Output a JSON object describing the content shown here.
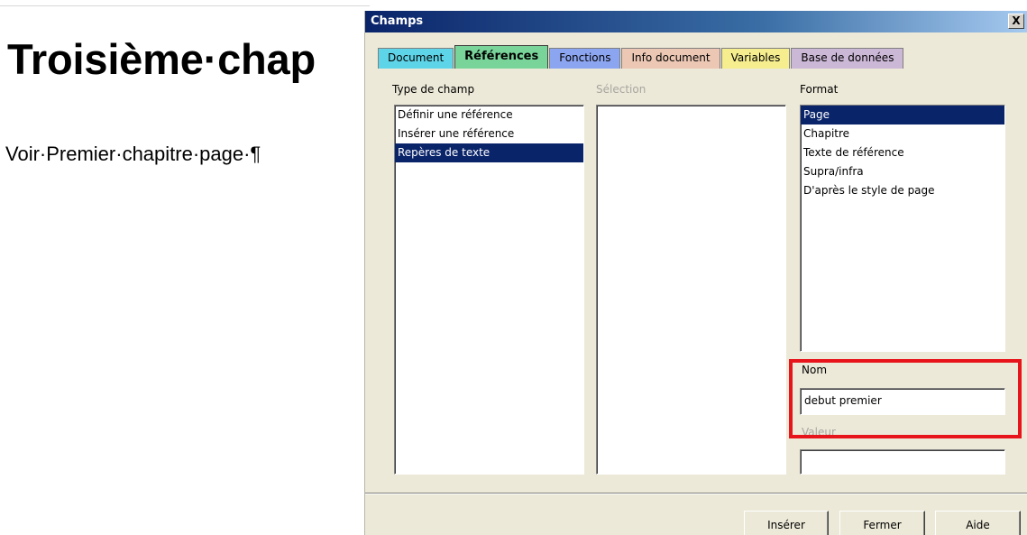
{
  "document": {
    "heading": "Troisième·chap",
    "paragraph": "Voir·Premier·chapitre·page·¶"
  },
  "dialog": {
    "title": "Champs",
    "close_glyph": "X",
    "tabs": [
      {
        "label": "Document",
        "color": "#5ed4e8"
      },
      {
        "label": "Références",
        "color": "#79d49a",
        "active": true
      },
      {
        "label": "Fonctions",
        "color": "#8ca5f0"
      },
      {
        "label": "Info document",
        "color": "#ecc7b4"
      },
      {
        "label": "Variables",
        "color": "#f5ed8e"
      },
      {
        "label": "Base de données",
        "color": "#cbb7d6"
      }
    ],
    "type_de_champ": {
      "label": "Type de champ",
      "items": [
        "Définir une référence",
        "Insérer une référence",
        "Repères de texte"
      ],
      "selected_index": 2
    },
    "selection": {
      "label": "Sélection",
      "items": []
    },
    "format": {
      "label": "Format",
      "items": [
        "Page",
        "Chapitre",
        "Texte de référence",
        "Supra/infra",
        "D'après le style de page"
      ],
      "selected_index": 0
    },
    "nom": {
      "label": "Nom",
      "value": "debut premier"
    },
    "valeur": {
      "label": "Valeur",
      "value": ""
    },
    "buttons": {
      "inserer": "Insérer",
      "fermer": "Fermer",
      "aide": "Aide"
    },
    "highlight_color": "#e8141b",
    "selection_color": "#0a246a"
  }
}
